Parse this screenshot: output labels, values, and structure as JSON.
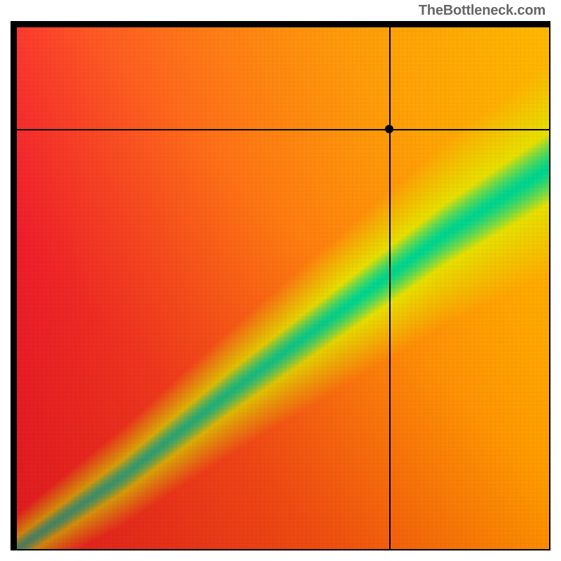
{
  "watermark": "TheBottleneck.com",
  "chart_data": {
    "type": "heatmap",
    "title": "",
    "xlabel": "",
    "ylabel": "",
    "xlim": [
      0,
      100
    ],
    "ylim": [
      0,
      100
    ],
    "crosshair": {
      "x": 70.0,
      "y": 80.5
    },
    "marker": {
      "x": 70.0,
      "y": 80.5
    },
    "optimal_band": {
      "description": "green diagonal band representing balanced configuration",
      "points": [
        {
          "x": 0,
          "y": 0
        },
        {
          "x": 20,
          "y": 14
        },
        {
          "x": 40,
          "y": 30
        },
        {
          "x": 60,
          "y": 45
        },
        {
          "x": 80,
          "y": 60
        },
        {
          "x": 100,
          "y": 73
        }
      ],
      "band_half_width_pct": 5
    },
    "gradient_corners": {
      "top_left": "#ff1f3a",
      "top_right": "#ffb300",
      "bottom_left": "#ff2a1f",
      "bottom_right": "#ff8a00",
      "band_center": "#00d68f",
      "band_edge": "#e8e000"
    },
    "note": "Values estimated from visual axes; no numeric tick labels present."
  }
}
